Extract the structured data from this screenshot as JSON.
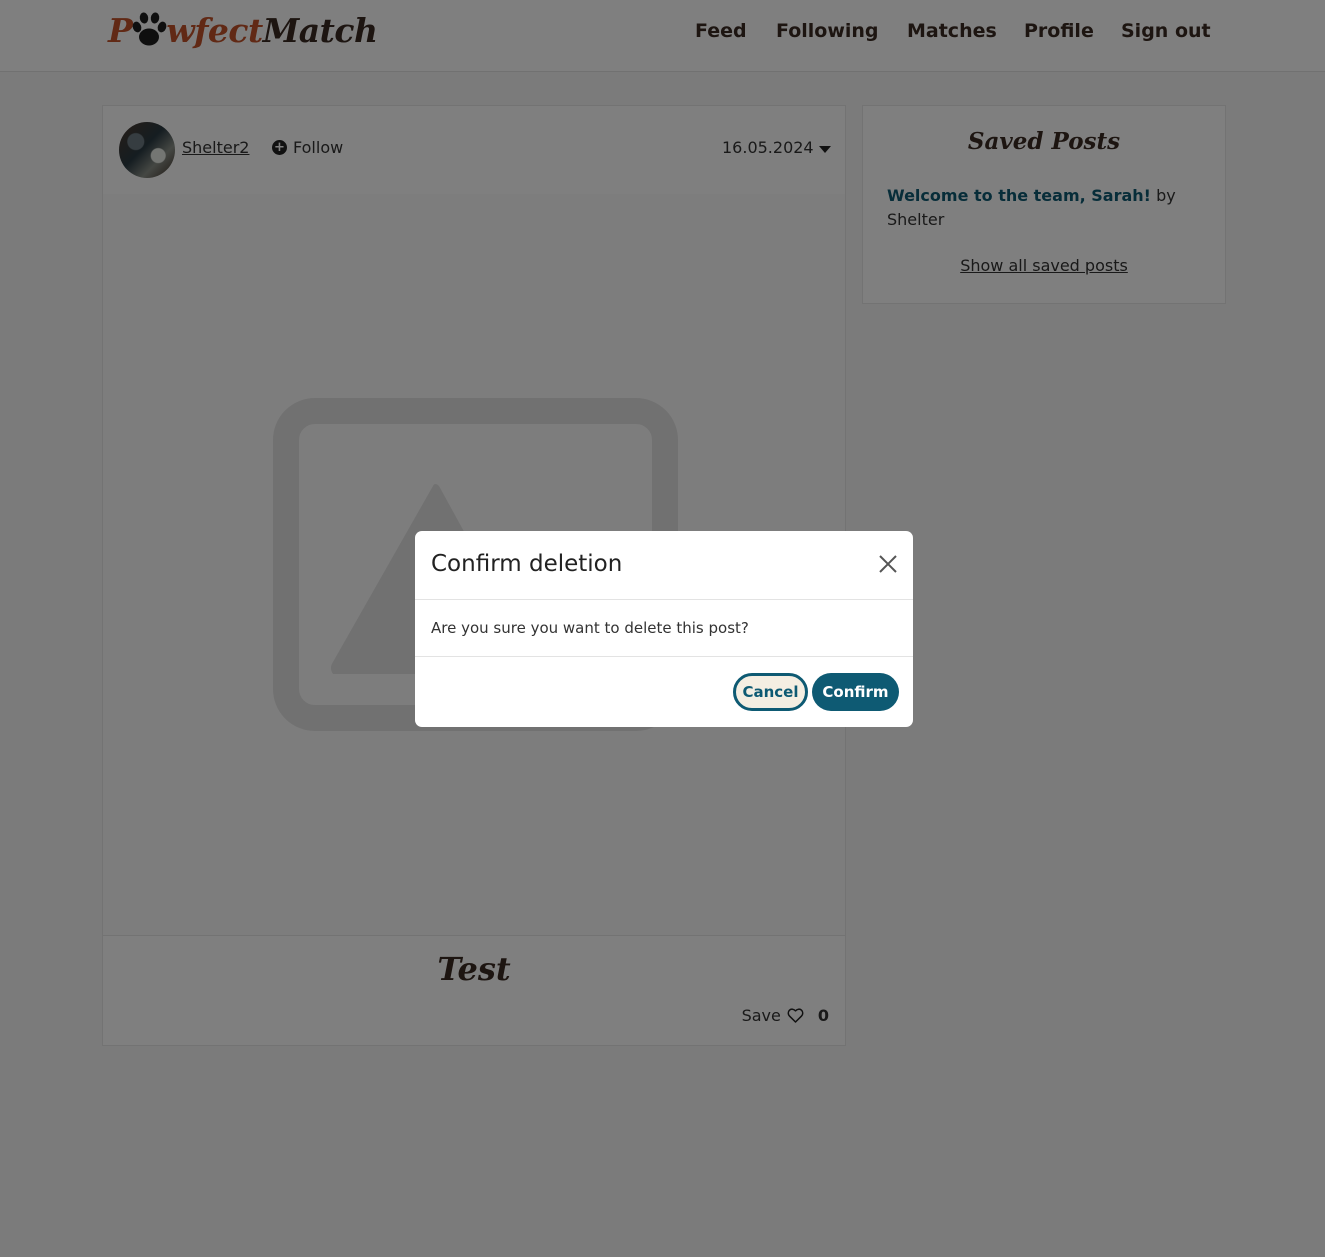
{
  "brand": {
    "logo_p": "P",
    "logo_wfect": "wfect",
    "logo_match": "Match",
    "accent_color": "#c2532a",
    "dark_color": "#3a2a22",
    "primary_color": "#0e5a73"
  },
  "nav": {
    "items": [
      {
        "label": "Feed"
      },
      {
        "label": "Following"
      },
      {
        "label": "Matches"
      },
      {
        "label": "Profile"
      },
      {
        "label": "Sign out"
      }
    ]
  },
  "post": {
    "author": "Shelter2",
    "follow_label": "Follow",
    "date": "16.05.2024",
    "title": "Test",
    "save_label": "Save",
    "save_count": "0",
    "image_icon": "image-placeholder-icon"
  },
  "saved": {
    "title": "Saved Posts",
    "items": [
      {
        "title": "Welcome to the team, Sarah!",
        "by": "by",
        "author": "Shelter"
      }
    ],
    "show_all": "Show all saved posts"
  },
  "modal": {
    "title": "Confirm deletion",
    "body": "Are you sure you want to delete this post?",
    "cancel_label": "Cancel",
    "confirm_label": "Confirm",
    "close_icon": "close-icon"
  }
}
